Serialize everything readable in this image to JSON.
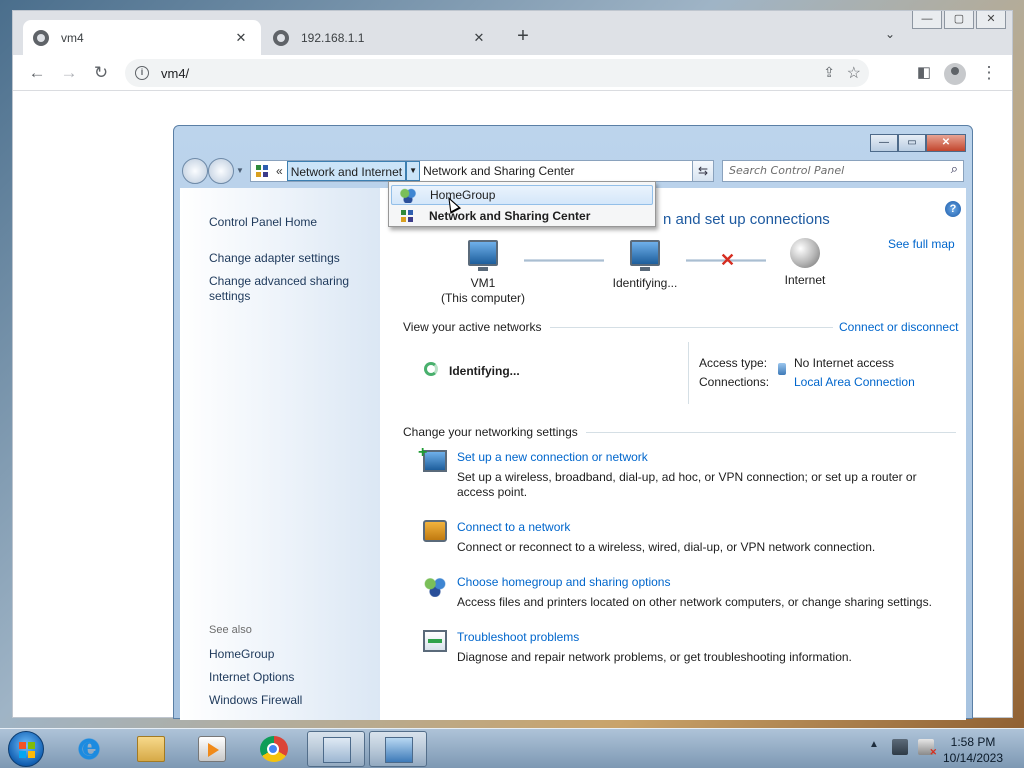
{
  "browser": {
    "tabs": [
      {
        "title": "vm4",
        "active": true
      },
      {
        "title": "192.168.1.1",
        "active": false
      }
    ],
    "new_tab": "+",
    "address": "vm4/",
    "colors": {
      "tabstrip": "#dee1e6",
      "omnibox": "#f1f3f4"
    }
  },
  "control_panel": {
    "breadcrumb": {
      "more": "«",
      "segment_1": "Network and Internet",
      "segment_2": "Network and Sharing Center"
    },
    "search_placeholder": "Search Control Panel",
    "dropdown_menu": [
      {
        "label": "HomeGroup",
        "icon": "homegroup-icon",
        "bold": false,
        "hover": true
      },
      {
        "label": "Network and Sharing Center",
        "icon": "network-center-icon",
        "bold": true,
        "hover": false
      }
    ],
    "left_pane": {
      "home": "Control Panel Home",
      "links": [
        "Change adapter settings",
        "Change advanced sharing settings"
      ],
      "see_also_label": "See also",
      "see_also": [
        "HomeGroup",
        "Internet Options",
        "Windows Firewall"
      ]
    },
    "main": {
      "title_partial": "n and set up connections",
      "see_full_map": "See full map",
      "map": {
        "computer_name": "VM1",
        "computer_sub": "(This computer)",
        "middle": "Identifying...",
        "internet": "Internet"
      },
      "active_networks": {
        "heading": "View your active networks",
        "action": "Connect or disconnect",
        "network_status": "Identifying...",
        "access_type_label": "Access type:",
        "access_type_value": "No Internet access",
        "connections_label": "Connections:",
        "connections_value": "Local Area Connection"
      },
      "settings": {
        "heading": "Change your networking settings",
        "tasks": [
          {
            "link": "Set up a new connection or network",
            "desc": "Set up a wireless, broadband, dial-up, ad hoc, or VPN connection; or set up a router or access point."
          },
          {
            "link": "Connect to a network",
            "desc": "Connect or reconnect to a wireless, wired, dial-up, or VPN network connection."
          },
          {
            "link": "Choose homegroup and sharing options",
            "desc": "Access files and printers located on other network computers, or change sharing settings."
          },
          {
            "link": "Troubleshoot problems",
            "desc": "Diagnose and repair network problems, or get troubleshooting information."
          }
        ]
      }
    },
    "colors": {
      "link": "#0066cc",
      "title": "#1e5aa0",
      "error_x": "#d62d20"
    }
  },
  "taskbar": {
    "time": "1:58 PM",
    "date": "10/14/2023"
  }
}
